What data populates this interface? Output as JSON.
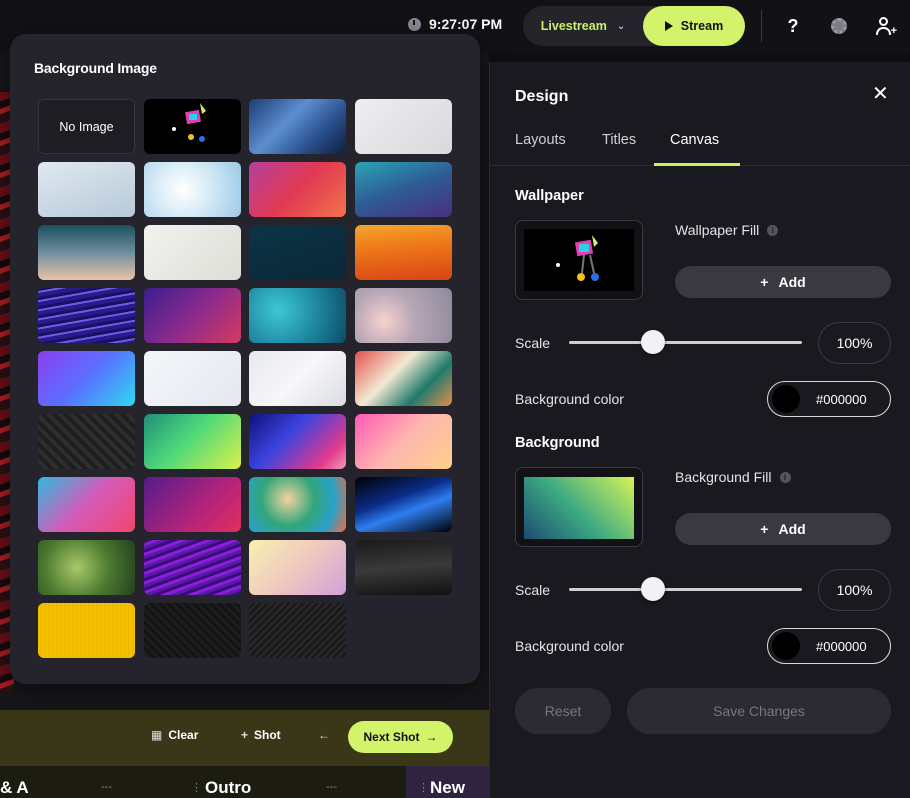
{
  "topbar": {
    "time": "9:27:07 PM",
    "livestream_label": "Livestream",
    "stream_label": "Stream",
    "help_label": "?"
  },
  "popover": {
    "title": "Background Image",
    "no_image_label": "No Image",
    "thumbnails": [
      "no-image",
      "mascot-black",
      "blue-glass-building",
      "white-paper-texture",
      "light-blue-lines",
      "sky-clouds",
      "red-pink-gradient",
      "teal-purple-gradient",
      "sunset-gradient",
      "white-fold",
      "dark-teal",
      "orange-curve",
      "purple-light-streaks",
      "purple-red-gradient",
      "teal-particles",
      "bokeh-lights",
      "violet-cyan-wave",
      "white-cracks",
      "white-waves",
      "tropical-leaves",
      "dark-pattern",
      "green-yellow-gradient",
      "blue-pink-blur",
      "pink-yellow-gradient",
      "blue-pink-paint",
      "magenta-purple",
      "colorful-blur",
      "dark-blue-geometric",
      "green-bokeh",
      "purple-wave-lines",
      "pastel-gradient",
      "black-dunes",
      "yellow-texture",
      "black-texture",
      "dark-diagonal-lines"
    ]
  },
  "bottom": {
    "clear_label": "Clear",
    "shot_label": "Shot",
    "next_shot_label": "Next Shot",
    "strip_left": "& A",
    "strip_mid": "Outro",
    "strip_right": "New",
    "dash": "---"
  },
  "panel": {
    "title": "Design",
    "tabs": [
      {
        "label": "Layouts"
      },
      {
        "label": "Titles"
      },
      {
        "label": "Canvas"
      }
    ],
    "active_tab": "Canvas",
    "accent": "#c8f169",
    "wallpaper": {
      "title": "Wallpaper",
      "fill_label": "Wallpaper Fill",
      "add_label": "Add",
      "scale_label": "Scale",
      "scale_value": "100%",
      "slider_fraction": 0.36,
      "bg_color_label": "Background color",
      "bg_color_value": "#000000"
    },
    "background": {
      "title": "Background",
      "fill_label": "Background Fill",
      "add_label": "Add",
      "scale_label": "Scale",
      "scale_value": "100%",
      "slider_fraction": 0.36,
      "bg_color_label": "Background color",
      "bg_color_value": "#000000"
    },
    "reset_label": "Reset",
    "save_label": "Save Changes"
  }
}
